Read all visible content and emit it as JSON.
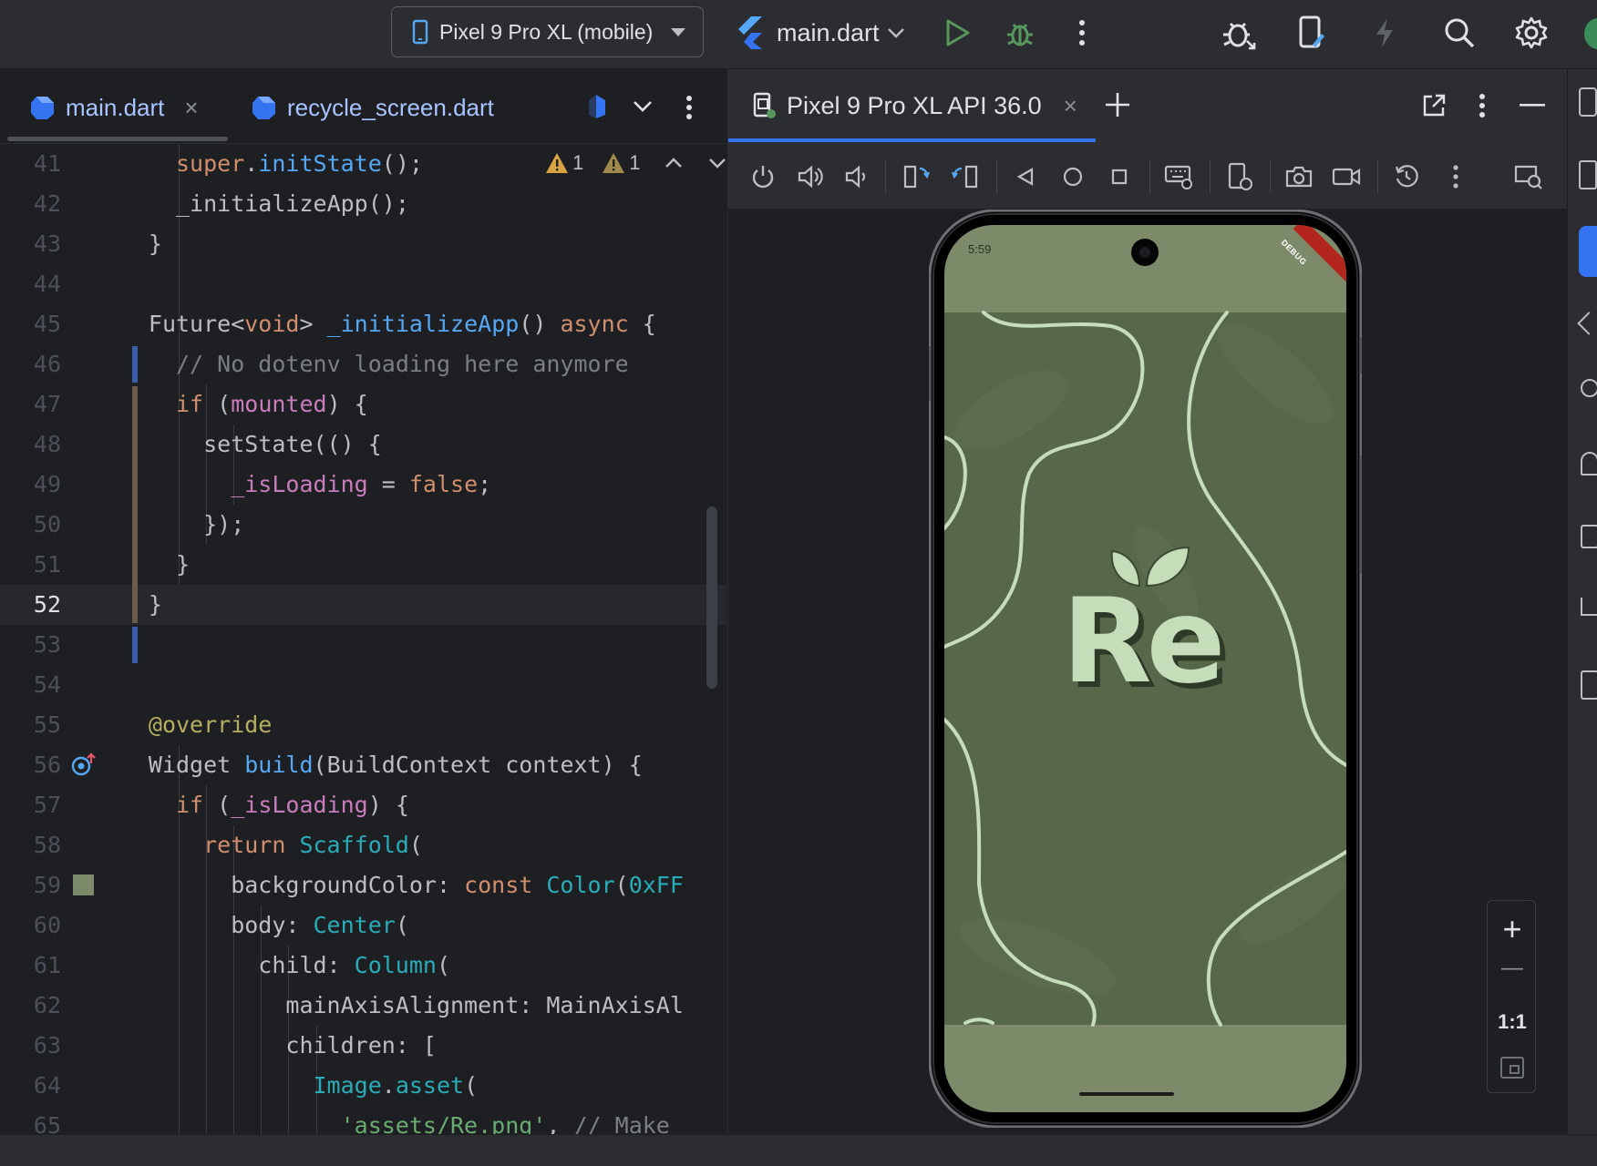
{
  "toolbar": {
    "device": "Pixel 9 Pro XL (mobile)",
    "run_config": "main.dart",
    "icons": [
      "phone-icon",
      "flutter-icon",
      "run-icon",
      "debug-icon",
      "more-icon",
      "profiler-icon",
      "device-manager-icon",
      "flash-icon",
      "search-icon",
      "settings-icon"
    ]
  },
  "editor": {
    "tabs": [
      {
        "label": "main.dart",
        "active": true
      },
      {
        "label": "recycle_screen.dart",
        "active": false
      }
    ],
    "inspections": {
      "warning_a": "1",
      "warning_b": "1"
    },
    "current_line": "52",
    "lines": [
      {
        "n": "41",
        "segments": [
          [
            "kw",
            "super"
          ],
          [
            "",
            "."
          ],
          [
            "fn",
            "initState"
          ],
          [
            "",
            "();"
          ]
        ]
      },
      {
        "n": "42",
        "segments": [
          [
            "",
            "_initializeApp();"
          ]
        ]
      },
      {
        "n": "43",
        "segments": [
          [
            "",
            "}"
          ]
        ]
      },
      {
        "n": "44",
        "segments": []
      },
      {
        "n": "45",
        "segments": [
          [
            "",
            "Future<"
          ],
          [
            "kw",
            "void"
          ],
          [
            "",
            "> "
          ],
          [
            "fn",
            "_initializeApp"
          ],
          [
            "",
            "() "
          ],
          [
            "kw",
            "async"
          ],
          [
            "",
            " {"
          ]
        ]
      },
      {
        "n": "46",
        "segments": [
          [
            "cm",
            "// No dotenv loading here anymore"
          ]
        ]
      },
      {
        "n": "47",
        "segments": [
          [
            "kw",
            "if"
          ],
          [
            "",
            " ("
          ],
          [
            "fld",
            "mounted"
          ],
          [
            "",
            ") {"
          ]
        ]
      },
      {
        "n": "48",
        "segments": [
          [
            "",
            "setState(() {"
          ]
        ]
      },
      {
        "n": "49",
        "segments": [
          [
            "fld",
            "_isLoading"
          ],
          [
            "",
            " = "
          ],
          [
            "kw",
            "false"
          ],
          [
            "",
            ";"
          ]
        ]
      },
      {
        "n": "50",
        "segments": [
          [
            "",
            "});"
          ]
        ]
      },
      {
        "n": "51",
        "segments": [
          [
            "",
            "}"
          ]
        ]
      },
      {
        "n": "52",
        "segments": [
          [
            "",
            "}"
          ]
        ]
      },
      {
        "n": "53",
        "segments": []
      },
      {
        "n": "54",
        "segments": []
      },
      {
        "n": "55",
        "segments": [
          [
            "ann",
            "@override"
          ]
        ]
      },
      {
        "n": "56",
        "segments": [
          [
            "",
            "Widget "
          ],
          [
            "fn",
            "build"
          ],
          [
            "",
            "(BuildContext context) {"
          ]
        ]
      },
      {
        "n": "57",
        "segments": [
          [
            "kw",
            "if"
          ],
          [
            "",
            " ("
          ],
          [
            "fld",
            "_isLoading"
          ],
          [
            "",
            ") {"
          ]
        ]
      },
      {
        "n": "58",
        "segments": [
          [
            "kw",
            "return "
          ],
          [
            "cls",
            "Scaffold"
          ],
          [
            "",
            "("
          ]
        ]
      },
      {
        "n": "59",
        "segments": [
          [
            "",
            "backgroundColor: "
          ],
          [
            "kw",
            "const "
          ],
          [
            "cls",
            "Color"
          ],
          [
            "",
            "("
          ],
          [
            "cls",
            "0xFF"
          ]
        ]
      },
      {
        "n": "60",
        "segments": [
          [
            "",
            "body: "
          ],
          [
            "cls",
            "Center"
          ],
          [
            "",
            "("
          ]
        ]
      },
      {
        "n": "61",
        "segments": [
          [
            "",
            "child: "
          ],
          [
            "cls",
            "Column"
          ],
          [
            "",
            "("
          ]
        ]
      },
      {
        "n": "62",
        "segments": [
          [
            "",
            "mainAxisAlignment: MainAxisAl"
          ]
        ]
      },
      {
        "n": "63",
        "segments": [
          [
            "",
            "children: ["
          ]
        ]
      },
      {
        "n": "64",
        "segments": [
          [
            "cls",
            "Image"
          ],
          [
            "",
            "."
          ],
          [
            "cls",
            "asset"
          ],
          [
            "",
            "("
          ]
        ]
      },
      {
        "n": "65",
        "segments": [
          [
            "str",
            "'assets/Re.png'"
          ],
          [
            "",
            ", "
          ],
          [
            "cm",
            "// Make"
          ]
        ]
      }
    ]
  },
  "emulator": {
    "tab_label": "Pixel 9 Pro XL API 36.0",
    "toolbar_icons": [
      "power-icon",
      "volume-up-icon",
      "volume-down-icon",
      "rotate-left-icon",
      "rotate-right-icon",
      "back-icon",
      "home-icon",
      "overview-icon",
      "keyboard-icon",
      "device-settings-icon",
      "screenshot-icon",
      "record-icon",
      "snapshot-icon",
      "more-icon",
      "display-mode-icon"
    ],
    "zoom": {
      "plus": "+",
      "minus": "—",
      "actual": "1:1"
    },
    "phone": {
      "status_time": "5:59",
      "debug_banner": "DEBUG",
      "logo_text": "Re",
      "bg_color": "#7c8a6a",
      "screen_color": "#57684a",
      "accent": "#c5ddb9"
    }
  },
  "colors": {
    "accent_blue": "#3574f0",
    "bg": "#1e1f22",
    "panel": "#2b2d30"
  }
}
